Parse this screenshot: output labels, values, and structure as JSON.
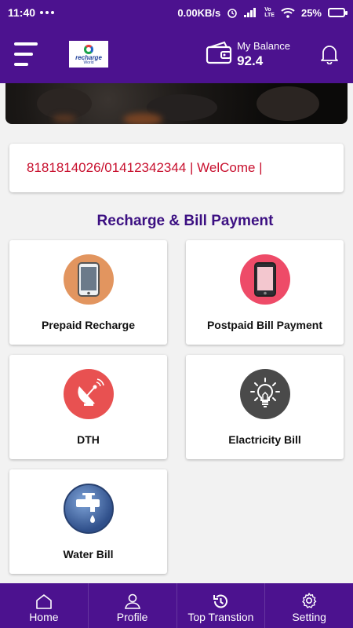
{
  "status_bar": {
    "time": "11:40",
    "network_speed": "0.00KB/s",
    "battery": "25%"
  },
  "app_bar": {
    "logo_text": "recharge",
    "logo_sub": "World",
    "balance_label": "My Balance",
    "balance_value": "92.4"
  },
  "marquee": {
    "text": "8181814026/01412342344  | WelCome |"
  },
  "section_title": "Recharge & Bill Payment",
  "services": [
    {
      "label": "Prepaid Recharge",
      "icon": "mobile-icon",
      "color": "#e2955f"
    },
    {
      "label": "Postpaid Bill Payment",
      "icon": "mobile-icon",
      "color": "#ee4b68"
    },
    {
      "label": "DTH",
      "icon": "satellite-dish-icon",
      "color": "#e85151"
    },
    {
      "label": "Elactricity Bill",
      "icon": "light-bulb-icon",
      "color": "#4a4a4a"
    },
    {
      "label": "Water Bill",
      "icon": "water-tap-icon",
      "color": "#3b5fa0"
    }
  ],
  "bottom_nav": {
    "home": "Home",
    "profile": "Profile",
    "top_transactions": "Top Transtion",
    "setting": "Setting"
  },
  "colors": {
    "brand_purple": "#4c128f",
    "title_purple": "#3c1082",
    "marquee_red": "#c8102e"
  }
}
